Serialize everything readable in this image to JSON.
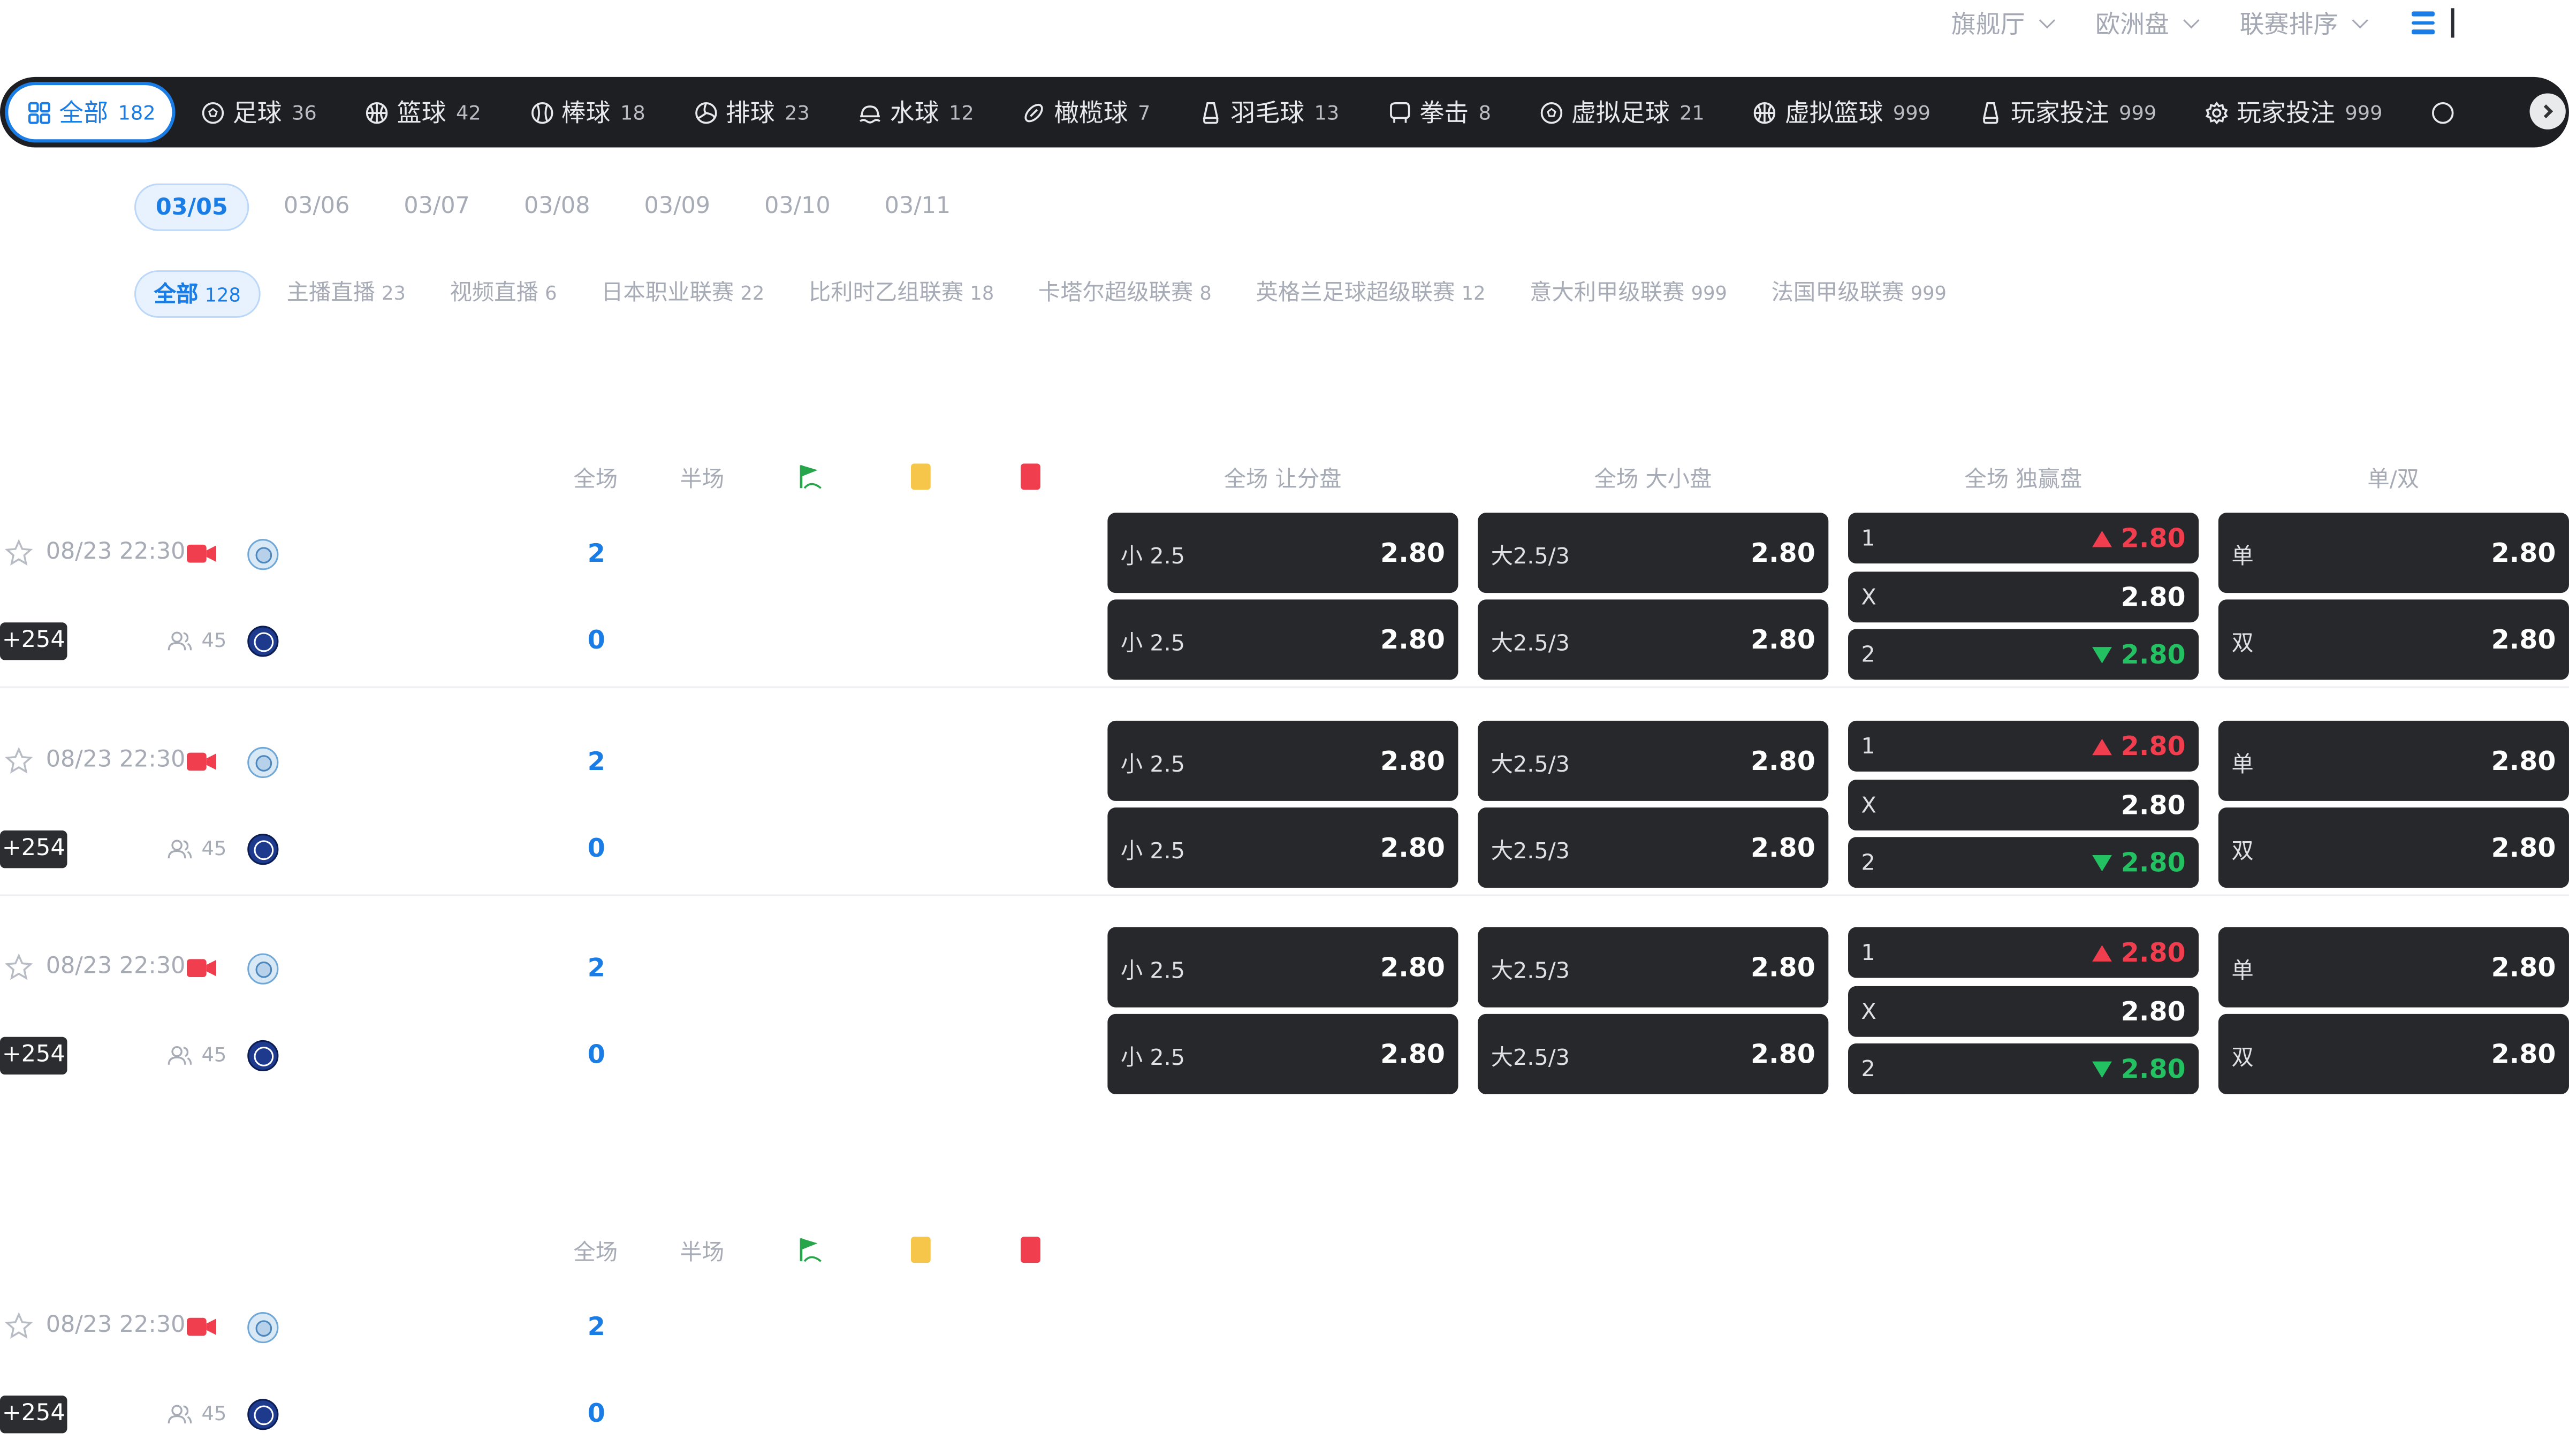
{
  "topbar": {
    "items": [
      "旗舰厅",
      "欧洲盘",
      "联赛排序"
    ]
  },
  "sports": [
    {
      "label": "全部",
      "count": "182",
      "icon": "grid-icon"
    },
    {
      "label": "足球",
      "count": "36",
      "icon": "soccer-icon"
    },
    {
      "label": "篮球",
      "count": "42",
      "icon": "basketball-icon"
    },
    {
      "label": "棒球",
      "count": "18",
      "icon": "baseball-icon"
    },
    {
      "label": "排球",
      "count": "23",
      "icon": "volleyball-icon"
    },
    {
      "label": "水球",
      "count": "12",
      "icon": "waterpolo-icon"
    },
    {
      "label": "橄榄球",
      "count": "7",
      "icon": "rugby-icon"
    },
    {
      "label": "羽毛球",
      "count": "13",
      "icon": "badminton-icon"
    },
    {
      "label": "拳击",
      "count": "8",
      "icon": "boxing-icon"
    },
    {
      "label": "虚拟足球",
      "count": "21",
      "icon": "soccer-icon"
    },
    {
      "label": "虚拟篮球",
      "count": "999",
      "icon": "basketball-icon"
    },
    {
      "label": "玩家投注",
      "count": "999",
      "icon": "badminton-icon"
    },
    {
      "label": "玩家投注",
      "count": "999",
      "icon": "gear-icon"
    }
  ],
  "dates": [
    "03/05",
    "03/06",
    "03/07",
    "03/08",
    "03/09",
    "03/10",
    "03/11"
  ],
  "leagues": [
    {
      "label": "全部",
      "count": "128"
    },
    {
      "label": "主播直播",
      "count": "23"
    },
    {
      "label": "视频直播",
      "count": "6"
    },
    {
      "label": "日本职业联赛",
      "count": "22"
    },
    {
      "label": "比利时乙组联赛",
      "count": "18"
    },
    {
      "label": "卡塔尔超级联赛",
      "count": "8"
    },
    {
      "label": "英格兰足球超级联赛",
      "count": "12"
    },
    {
      "label": "意大利甲级联赛",
      "count": "999"
    },
    {
      "label": "法国甲级联赛",
      "count": "999"
    }
  ],
  "columns": {
    "full": "全场",
    "half": "半场",
    "handicap": "全场 让分盘",
    "overunder": "全场 大小盘",
    "moneyline": "全场 独赢盘",
    "oddeven": "单/双"
  },
  "colors": {
    "accent": "#1a7de6",
    "up": "#f03e4f",
    "down": "#23c162",
    "dark": "#27282c"
  },
  "match": {
    "time": "08/23 22:30",
    "more": "+254",
    "viewers": "45",
    "score_home": "2",
    "score_away": "0",
    "handicap": [
      {
        "label": "小 2.5",
        "odds": "2.80"
      },
      {
        "label": "小 2.5",
        "odds": "2.80"
      }
    ],
    "overunder": [
      {
        "label": "大2.5/3",
        "odds": "2.80"
      },
      {
        "label": "大2.5/3",
        "odds": "2.80"
      }
    ],
    "moneyline": [
      {
        "label": "1",
        "odds": "2.80"
      },
      {
        "label": "X",
        "odds": "2.80"
      },
      {
        "label": "2",
        "odds": "2.80"
      }
    ],
    "oddeven": [
      {
        "label": "单",
        "odds": "2.80"
      },
      {
        "label": "双",
        "odds": "2.80"
      }
    ]
  }
}
